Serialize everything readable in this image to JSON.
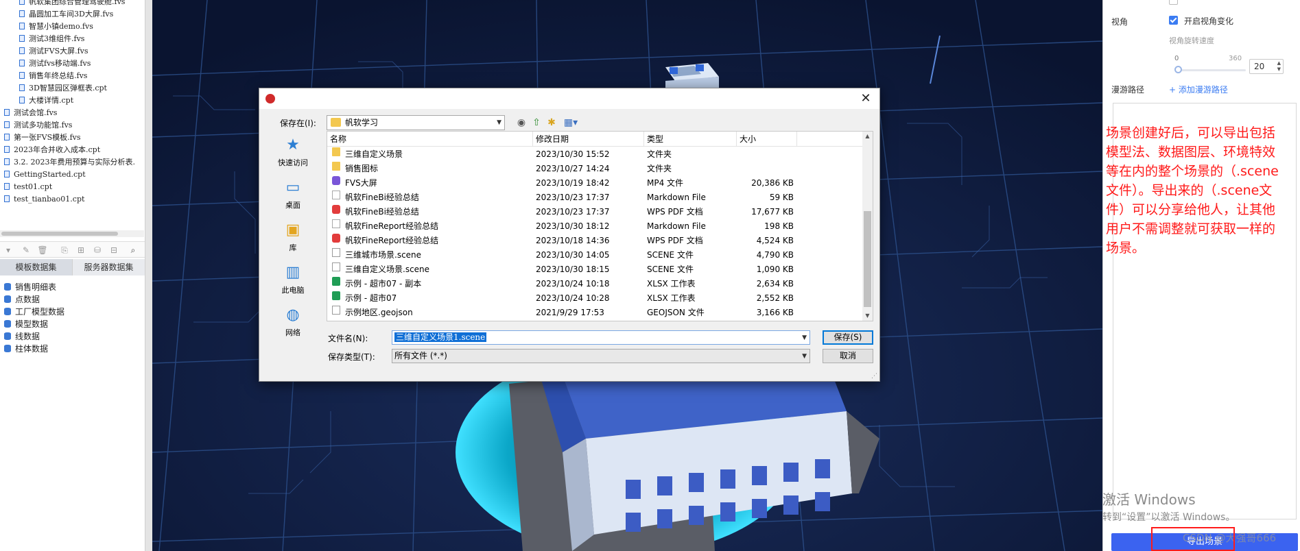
{
  "left_panel": {
    "files": [
      "帆软集团综合管理驾驶舱.fvs",
      "晶圆加工车间3D大屏.fvs",
      "智慧小镇demo.fvs",
      "测试3维组件.fvs",
      "测试FVS大屏.fvs",
      "测试fvs移动端.fvs",
      "销售年终总结.fvs",
      "3D智慧园区弹框表.cpt",
      "大楼详情.cpt",
      "测试会馆.fvs",
      "测试多功能馆.fvs",
      "第一张FVS模板.fvs",
      "2023年合并收入成本.cpt",
      "3.2. 2023年费用预算与实际分析表.",
      "GettingStarted.cpt",
      "test01.cpt",
      "test_tianbao01.cpt"
    ],
    "dataset_tabs": [
      "模板数据集",
      "服务器数据集"
    ],
    "datasets": [
      "销售明细表",
      "点数据",
      "工厂模型数据",
      "模型数据",
      "线数据",
      "柱体数据"
    ]
  },
  "right_panel": {
    "view_angle_label": "视角",
    "view_angle_checkbox": "开启视角变化",
    "rotate_speed_label": "视角旋转速度",
    "slider_min": "0",
    "slider_max": "360",
    "slider_value": 0.0,
    "speed_value": "20",
    "roam_path_label": "漫游路径",
    "add_roam_path": "+ 添加漫游路径",
    "export_button": "导出场景"
  },
  "annotation": "场景创建好后，可以导出包括模型法、数据图层、环境特效等在内的整个场景的（.scene文件）。导出来的（.scene文件）可以分享给他人，让其他用户不需调整就可获取一样的场景。",
  "watermark": {
    "line1": "激活 Windows",
    "line2": "转到“设置”以激活 Windows。",
    "csdn": "CSDN @大强哥666"
  },
  "dialog": {
    "save_in_label": "保存在(I):",
    "save_in_value": "帆软学习",
    "places": [
      "快速访问",
      "桌面",
      "库",
      "此电脑",
      "网络"
    ],
    "columns": [
      "名称",
      "修改日期",
      "类型",
      "大小"
    ],
    "files": [
      {
        "name": "三维自定义场景",
        "date": "2023/10/30 15:52",
        "type": "文件夹",
        "size": "",
        "icon": "folder"
      },
      {
        "name": "销售图标",
        "date": "2023/10/27 14:24",
        "type": "文件夹",
        "size": "",
        "icon": "folder"
      },
      {
        "name": "FVS大屏",
        "date": "2023/10/19 18:42",
        "type": "MP4 文件",
        "size": "20,386 KB",
        "icon": "mp4"
      },
      {
        "name": "帆软FineBi经验总结",
        "date": "2023/10/23 17:37",
        "type": "Markdown File",
        "size": "59 KB",
        "icon": "md"
      },
      {
        "name": "帆软FineBi经验总结",
        "date": "2023/10/23 17:37",
        "type": "WPS PDF 文档",
        "size": "17,677 KB",
        "icon": "pdf"
      },
      {
        "name": "帆软FineReport经验总结",
        "date": "2023/10/30 18:12",
        "type": "Markdown File",
        "size": "198 KB",
        "icon": "md"
      },
      {
        "name": "帆软FineReport经验总结",
        "date": "2023/10/18 14:36",
        "type": "WPS PDF 文档",
        "size": "4,524 KB",
        "icon": "pdf"
      },
      {
        "name": "三维城市场景.scene",
        "date": "2023/10/30 14:05",
        "type": "SCENE 文件",
        "size": "4,790 KB",
        "icon": "scene"
      },
      {
        "name": "三维自定义场景.scene",
        "date": "2023/10/30 18:15",
        "type": "SCENE 文件",
        "size": "1,090 KB",
        "icon": "scene"
      },
      {
        "name": "示例 - 超市07 - 副本",
        "date": "2023/10/24 10:18",
        "type": "XLSX 工作表",
        "size": "2,634 KB",
        "icon": "xlsx"
      },
      {
        "name": "示例 - 超市07",
        "date": "2023/10/24 10:28",
        "type": "XLSX 工作表",
        "size": "2,552 KB",
        "icon": "xlsx"
      },
      {
        "name": "示例地区.geojson",
        "date": "2021/9/29 17:53",
        "type": "GEOJSON 文件",
        "size": "3,166 KB",
        "icon": "geo"
      }
    ],
    "filename_label": "文件名(N):",
    "filename_value": "三维自定义场景1.scene",
    "filetype_label": "保存类型(T):",
    "filetype_value": "所有文件 (*.*)",
    "save_button": "保存(S)",
    "cancel_button": "取消"
  }
}
